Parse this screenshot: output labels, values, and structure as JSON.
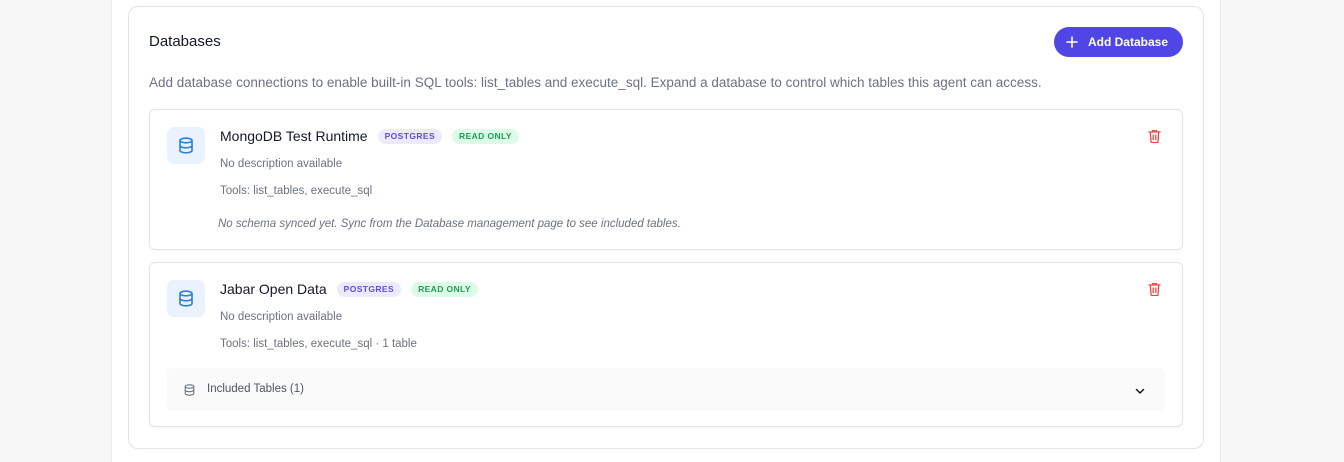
{
  "section": {
    "title": "Databases",
    "add_button_label": "Add Database",
    "description": "Add database connections to enable built-in SQL tools: list_tables and execute_sql. Expand a database to control which tables this agent can access."
  },
  "databases": [
    {
      "name": "MongoDB Test Runtime",
      "engine_badge": "POSTGRES",
      "access_badge": "READ ONLY",
      "description": "No description available",
      "tools": "Tools: list_tables, execute_sql",
      "note": "No schema synced yet. Sync from the Database management page to see included tables."
    },
    {
      "name": "Jabar Open Data",
      "engine_badge": "POSTGRES",
      "access_badge": "READ ONLY",
      "description": "No description available",
      "tools": "Tools: list_tables, execute_sql · 1 table",
      "included_tables_label": "Included Tables (1)"
    }
  ],
  "icons": {
    "add": "plus-icon",
    "database": "database-icon",
    "delete": "trash-icon",
    "expand": "chevron-down-icon"
  },
  "colors": {
    "accent": "#4f46e5",
    "db_icon": "#2b7fd8",
    "delete": "#ef4444",
    "engine_badge_text": "#5b50d6",
    "access_badge_text": "#1f9d55"
  }
}
